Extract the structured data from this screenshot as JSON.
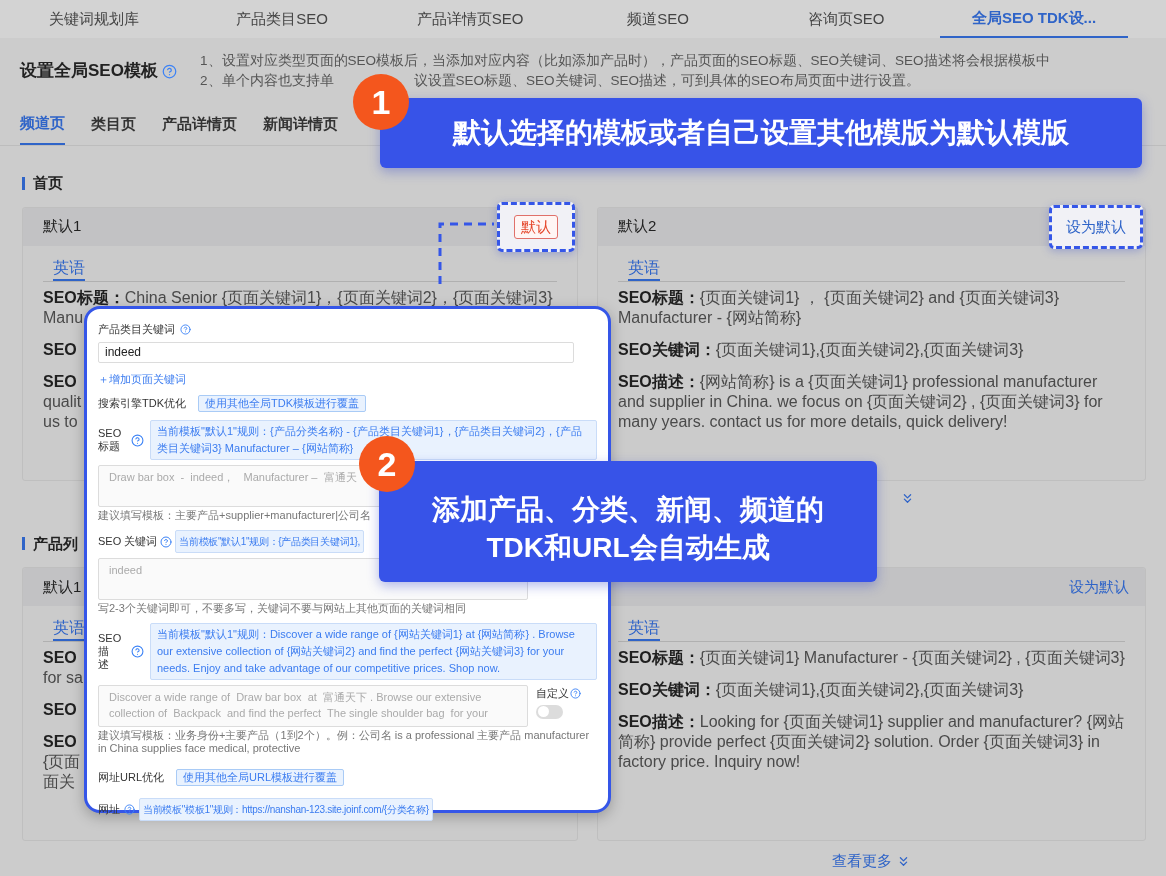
{
  "top_tabs": [
    {
      "label": "关键词规划库",
      "selected": false
    },
    {
      "label": "产品类目SEO",
      "selected": false
    },
    {
      "label": "产品详情页SEO",
      "selected": false
    },
    {
      "label": "频道SEO",
      "selected": false
    },
    {
      "label": "咨询页SEO",
      "selected": false
    },
    {
      "label": "全局SEO TDK设...",
      "selected": true
    }
  ],
  "page_title": "设置全局SEO模板",
  "notes": [
    [
      "1、设置对应类型页面的SEO模板后，当添加对应内容（比如添加产品时），产品页面的SEO标题、SEO关键词、SEO描述将会根据模板中"
    ],
    [
      "2、单个内容也支持单",
      "议设置SEO标题、SEO关键词、SEO描述，可到具体的SEO布局页面中进行设置。"
    ]
  ],
  "sub_tabs": [
    {
      "label": "频道页",
      "selected": true
    },
    {
      "label": "类目页",
      "selected": false
    },
    {
      "label": "产品详情页",
      "selected": false
    },
    {
      "label": "新闻详情页",
      "selected": false
    }
  ],
  "sections": [
    {
      "title": "首页",
      "cards": [
        {
          "name": "默认1",
          "action": {
            "kind": "tag",
            "label": "默认",
            "highlighted": true
          },
          "language": "英语",
          "lines": [
            {
              "kind": "head",
              "label": "SEO标题：",
              "text": "China Senior {页面关键词1}，{页面关键词2}，{页面关键词3}"
            },
            {
              "kind": "wrap",
              "text": "Manu"
            },
            {
              "kind": "head",
              "label": "SEO"
            },
            {
              "kind": "head",
              "label": "SEO"
            },
            {
              "kind": "wrap",
              "text": "qualit"
            },
            {
              "kind": "wrap",
              "text": "us to"
            }
          ]
        },
        {
          "name": "默认2",
          "action": {
            "kind": "link",
            "label": "设为默认",
            "highlighted": true
          },
          "language": "英语",
          "lines": [
            {
              "kind": "head",
              "label": "SEO标题：",
              "text": "{页面关键词1} ， {页面关键词2} and {页面关键词3} Manufacturer - {网站简称}"
            },
            {
              "kind": "head",
              "label": "SEO关键词：",
              "text": "{页面关键词1},{页面关键词2},{页面关键词3}"
            },
            {
              "kind": "head",
              "label": "SEO描述：",
              "text": "{网站简称} is a {页面关键词1} professional manufacturer and supplier in China. we focus on {页面关键词2} , {页面关键词3} for many years. contact us for more details, quick delivery!"
            }
          ],
          "more": {
            "kind": "icon"
          }
        }
      ]
    },
    {
      "title": "产品列",
      "cards": [
        {
          "name": "默认1",
          "language": "英语",
          "lines": [
            {
              "kind": "head",
              "label": "SEO"
            },
            {
              "kind": "wrap",
              "text": "for sa"
            },
            {
              "kind": "head",
              "label": "SEO"
            },
            {
              "kind": "head",
              "label": "SEO"
            },
            {
              "kind": "wrap",
              "text": "{页面"
            },
            {
              "kind": "wrap",
              "text": "面关"
            }
          ]
        },
        {
          "action": {
            "kind": "link",
            "label": "设为默认",
            "highlighted": false
          },
          "language": "英语",
          "lines": [
            {
              "kind": "head",
              "label": "SEO标题：",
              "text": "{页面关键词1} Manufacturer - {页面关键词2} , {页面关键词3}"
            },
            {
              "kind": "head",
              "label": "SEO关键词：",
              "text": "{页面关键词1},{页面关键词2},{页面关键词3}"
            },
            {
              "kind": "head",
              "label": "SEO描述：",
              "text": "Looking for {页面关键词1} supplier and manufacturer? {网站简称} provide perfect {页面关键词2} solution. Order {页面关键词3} in factory price. Inquiry now!"
            }
          ],
          "more": {
            "kind": "text",
            "label": "查看更多"
          }
        }
      ]
    }
  ],
  "popup": {
    "keyword_label": "产品类目关键词",
    "keyword_value": "indeed",
    "add_link": "＋增加页面关键词",
    "tdk_label": "搜索引擎TDK优化",
    "tdk_button": "使用其他全局TDK模板进行覆盖",
    "fields": [
      {
        "kind": "stacked",
        "label_lines": [
          "SEO",
          "标题"
        ],
        "rule": "当前模板\"默认1\"规则：{产品分类名称} - {产品类目关键词1}，{产品类目关键词2}，{产品类目关键词3} Manufacturer – {网站简称}",
        "value": "Draw bar box  -  indeed，   Manufacturer –  富通天",
        "hint": "建议填写模板：主要产品+supplier+manufacturer|公司名"
      },
      {
        "kind": "inline",
        "label_lines": [
          "SEO 关键词"
        ],
        "rule": "当前模板\"默认1\"规则：{产品类目关键词1},",
        "value": "indeed",
        "hint": "写2-3个关键词即可，不要多写，关键词不要与网站上其他页面的关键词相同"
      },
      {
        "kind": "stacked",
        "label_lines": [
          "SEO",
          "描",
          "述"
        ],
        "rule": "当前模板\"默认1\"规则：Discover a wide range of {网站关键词1} at {网站简称} . Browse our extensive collection of {网站关键词2} and find the perfect {网站关键词3} for your needs. Enjoy and take advantage of our competitive prices. Shop now.",
        "value": "Discover a wide range of  Draw bar box  at  富通天下 . Browse our extensive collection of  Backpack  and find the perfect  The single shoulder bag  for your",
        "hint": "建议填写模板：业务身份+主要产品（1到2个）。例：公司名 is a professional 主要产品 manufacturer in China supplies face medical, protective",
        "custom": {
          "label": "自定义",
          "on": false
        }
      }
    ],
    "url_label": "网址URL优化",
    "url_button": "使用其他全局URL模板进行覆盖",
    "url_field": {
      "label": "网址",
      "rule": "当前模板\"模板1\"规则：https://nanshan-123.site.joinf.com/{分类名称}"
    }
  },
  "callouts": [
    {
      "number": "1",
      "lines": [
        "默认选择的模板或者自己设置其他模版为默认模版"
      ]
    },
    {
      "number": "2",
      "lines": [
        "添加产品、分类、新闻、频道的",
        "TDK和URL会自动生成"
      ]
    }
  ]
}
